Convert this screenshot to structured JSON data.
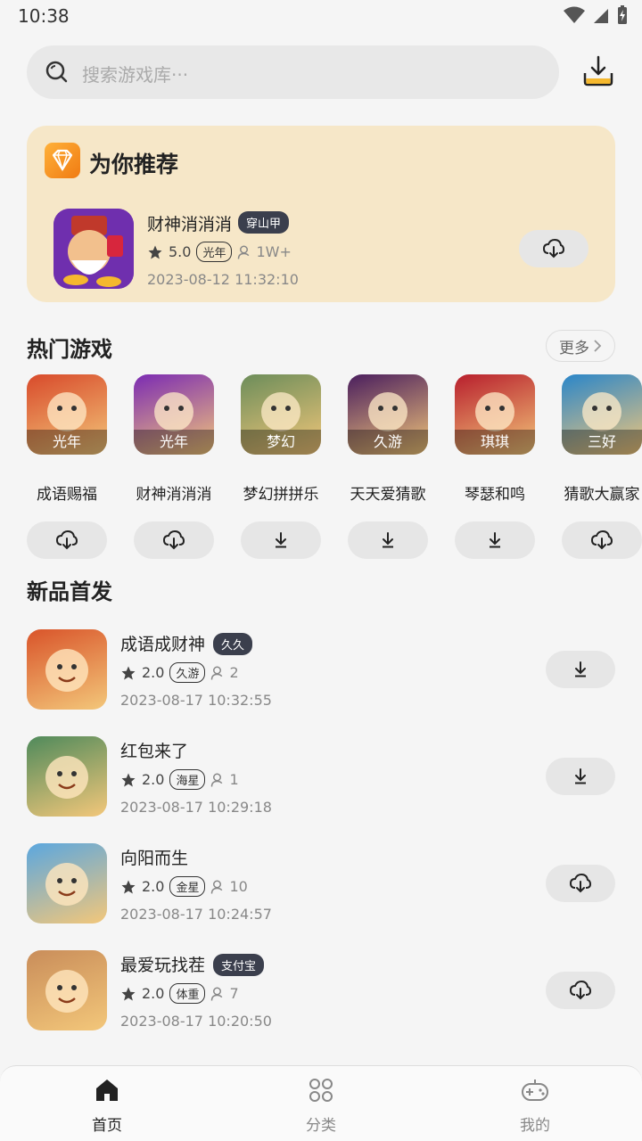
{
  "status": {
    "time": "10:38"
  },
  "search": {
    "placeholder": "搜索游戏库···"
  },
  "recommend": {
    "title": "为你推荐",
    "app": {
      "name": "财神消消消",
      "tag": "穿山甲",
      "rating": "5.0",
      "publisher": "光年",
      "users": "1W+",
      "time": "2023-08-12 11:32:10",
      "button": "cloud-download-icon"
    }
  },
  "hot": {
    "title": "热门游戏",
    "more": "更多",
    "items": [
      {
        "name": "成语赐福",
        "publisher": "光年",
        "button": "cloud-download-icon",
        "color": "#d84a2b"
      },
      {
        "name": "财神消消消",
        "publisher": "光年",
        "button": "cloud-download-icon",
        "color": "#7b2bb3"
      },
      {
        "name": "梦幻拼拼乐",
        "publisher": "梦幻",
        "button": "download-icon",
        "color": "#6c8d5a"
      },
      {
        "name": "天天爱猜歌",
        "publisher": "久游",
        "button": "download-icon",
        "color": "#4a1e5e"
      },
      {
        "name": "琴瑟和鸣",
        "publisher": "琪琪",
        "button": "download-icon",
        "color": "#b81f2d"
      },
      {
        "name": "猜歌大赢家",
        "publisher": "三好",
        "button": "cloud-download-icon",
        "color": "#2a86c9"
      }
    ]
  },
  "new": {
    "title": "新品首发",
    "items": [
      {
        "name": "成语成财神",
        "tag": "久久",
        "rating": "2.0",
        "publisher": "久游",
        "users": "2",
        "time": "2023-08-17 10:32:55",
        "button": "download-icon",
        "color": "#d9542a"
      },
      {
        "name": "红包来了",
        "tag": "",
        "rating": "2.0",
        "publisher": "海星",
        "users": "1",
        "time": "2023-08-17 10:29:18",
        "button": "download-icon",
        "color": "#4f8a5b"
      },
      {
        "name": "向阳而生",
        "tag": "",
        "rating": "2.0",
        "publisher": "金星",
        "users": "10",
        "time": "2023-08-17 10:24:57",
        "button": "cloud-download-icon",
        "color": "#5ba7df"
      },
      {
        "name": "最爱玩找茬",
        "tag": "支付宝",
        "rating": "2.0",
        "publisher": "体重",
        "users": "7",
        "time": "2023-08-17 10:20:50",
        "button": "cloud-download-icon",
        "color": "#c98d5a"
      }
    ]
  },
  "nav": {
    "items": [
      {
        "label": "首页",
        "icon": "home-icon",
        "active": true
      },
      {
        "label": "分类",
        "icon": "category-icon",
        "active": false
      },
      {
        "label": "我的",
        "icon": "gamepad-icon",
        "active": false
      }
    ]
  }
}
